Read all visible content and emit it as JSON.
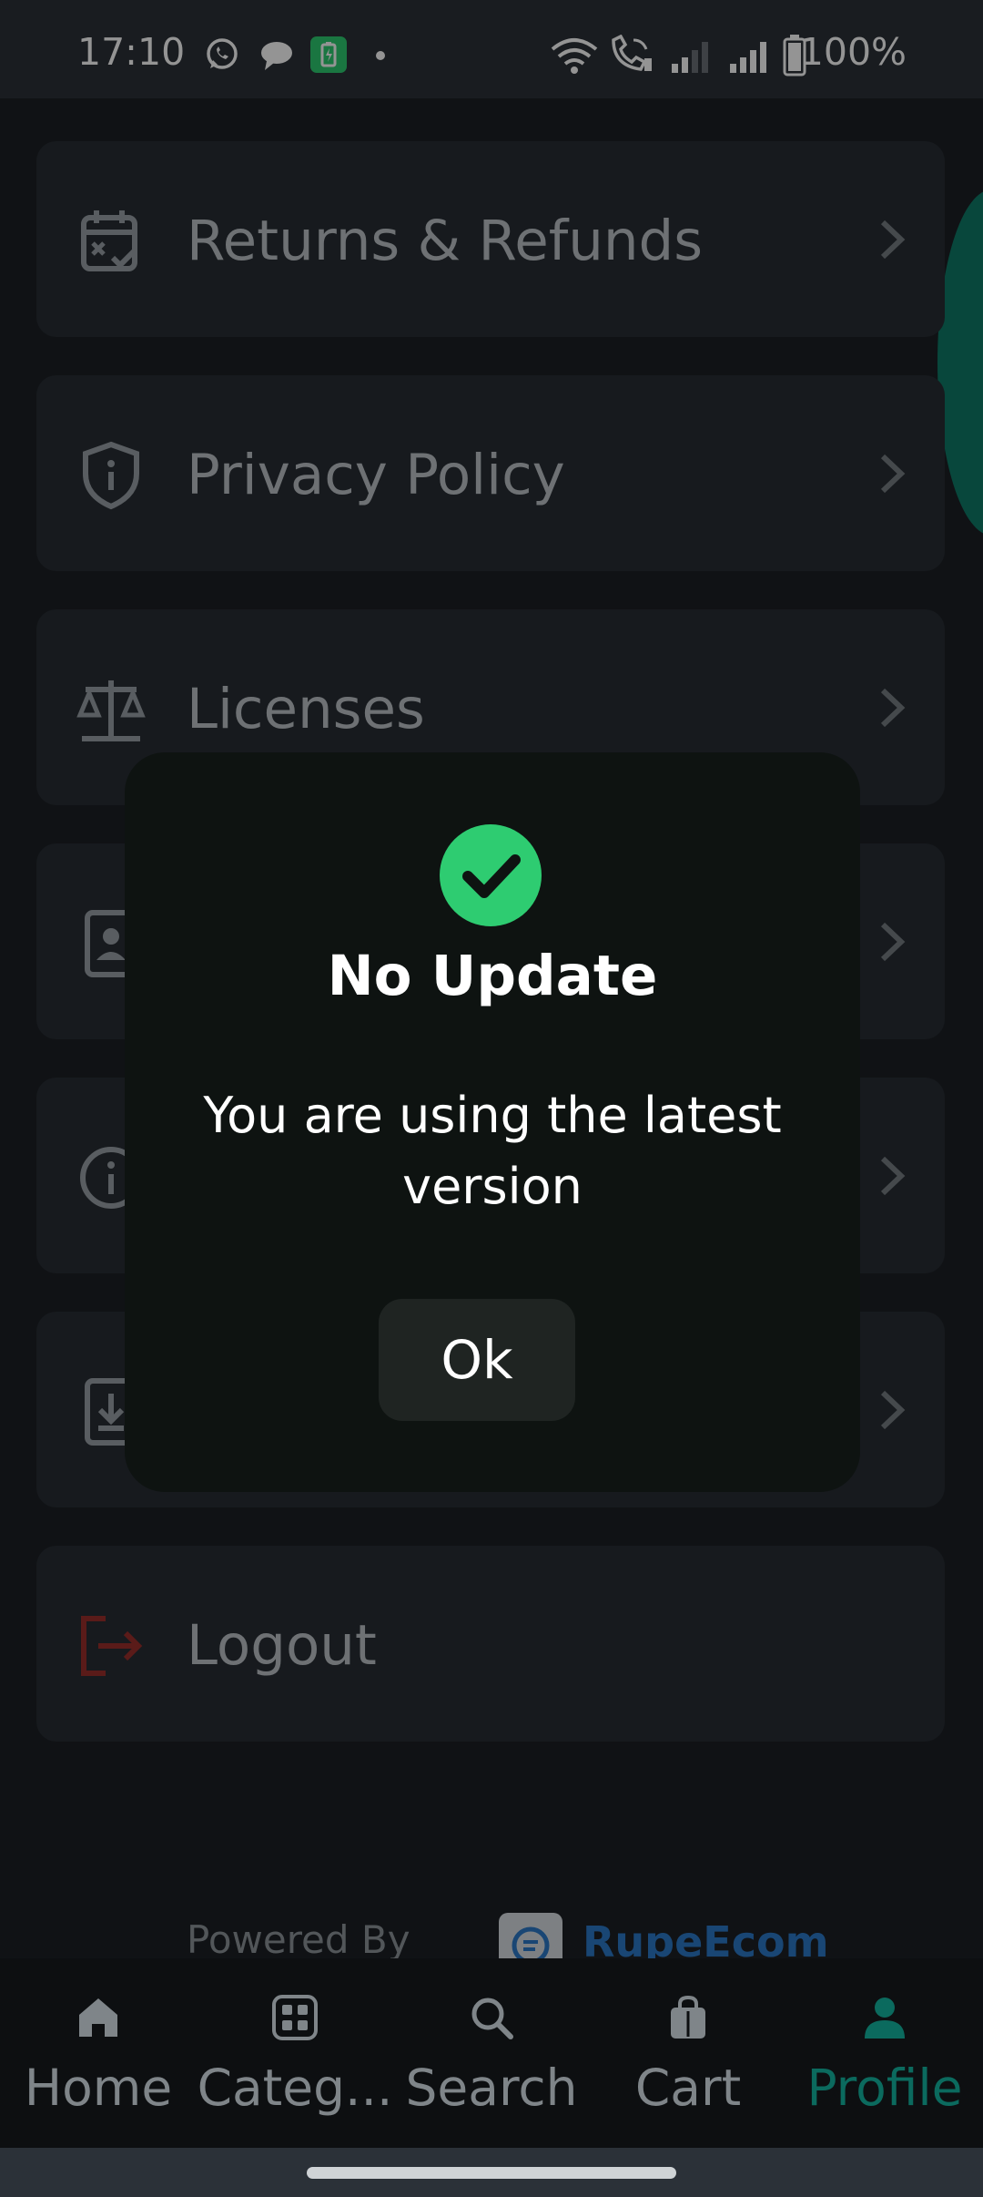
{
  "status_bar": {
    "time": "17:10",
    "battery_percent": "100%",
    "icons": [
      "whatsapp-icon",
      "chat-bubble-icon",
      "battery-saver-app-icon",
      "dot-icon",
      "wifi-icon",
      "wifi-calling-icon",
      "signal-weak-icon",
      "signal-full-icon",
      "battery-icon"
    ]
  },
  "menu": {
    "items": [
      {
        "label": "Returns & Refunds",
        "icon": "calendar-check-icon"
      },
      {
        "label": "Privacy Policy",
        "icon": "shield-info-icon"
      },
      {
        "label": "Licenses",
        "icon": "scale-balance-icon"
      },
      {
        "label": "",
        "icon": "contact-icon"
      },
      {
        "label": "",
        "icon": "info-icon"
      },
      {
        "label": "",
        "icon": "download-icon"
      },
      {
        "label": "Logout",
        "icon": "logout-icon"
      }
    ]
  },
  "footer": {
    "powered_by": "Powered By",
    "brand_name": "RupeEcom"
  },
  "dialog": {
    "icon": "check-circle-icon",
    "title": "No Update",
    "message": "You are using the latest version",
    "ok_label": "Ok"
  },
  "bottom_nav": {
    "items": [
      {
        "label": "Home",
        "icon": "home-icon"
      },
      {
        "label": "Categ...",
        "icon": "grid-icon"
      },
      {
        "label": "Search",
        "icon": "search-icon"
      },
      {
        "label": "Cart",
        "icon": "bag-icon"
      },
      {
        "label": "Profile",
        "icon": "person-icon"
      }
    ],
    "active": "Profile"
  },
  "colors": {
    "accent": "#0b6a5e",
    "success": "#2ecc71",
    "logout_red": "#9b2f2c",
    "brand_blue": "#2c79c9"
  }
}
